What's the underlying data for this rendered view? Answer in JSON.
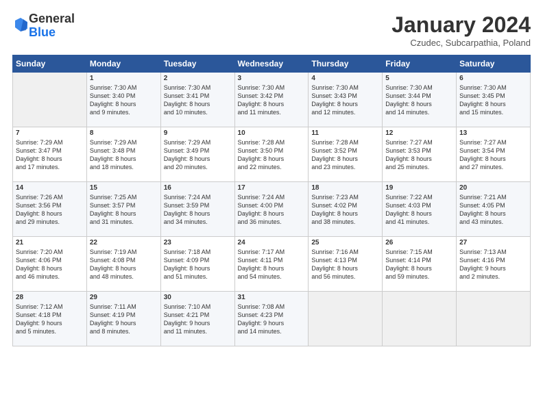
{
  "header": {
    "logo_general": "General",
    "logo_blue": "Blue",
    "month": "January 2024",
    "location": "Czudec, Subcarpathia, Poland"
  },
  "days_of_week": [
    "Sunday",
    "Monday",
    "Tuesday",
    "Wednesday",
    "Thursday",
    "Friday",
    "Saturday"
  ],
  "weeks": [
    [
      {
        "day": "",
        "text": ""
      },
      {
        "day": "1",
        "text": "Sunrise: 7:30 AM\nSunset: 3:40 PM\nDaylight: 8 hours\nand 9 minutes."
      },
      {
        "day": "2",
        "text": "Sunrise: 7:30 AM\nSunset: 3:41 PM\nDaylight: 8 hours\nand 10 minutes."
      },
      {
        "day": "3",
        "text": "Sunrise: 7:30 AM\nSunset: 3:42 PM\nDaylight: 8 hours\nand 11 minutes."
      },
      {
        "day": "4",
        "text": "Sunrise: 7:30 AM\nSunset: 3:43 PM\nDaylight: 8 hours\nand 12 minutes."
      },
      {
        "day": "5",
        "text": "Sunrise: 7:30 AM\nSunset: 3:44 PM\nDaylight: 8 hours\nand 14 minutes."
      },
      {
        "day": "6",
        "text": "Sunrise: 7:30 AM\nSunset: 3:45 PM\nDaylight: 8 hours\nand 15 minutes."
      }
    ],
    [
      {
        "day": "7",
        "text": "Sunrise: 7:29 AM\nSunset: 3:47 PM\nDaylight: 8 hours\nand 17 minutes."
      },
      {
        "day": "8",
        "text": "Sunrise: 7:29 AM\nSunset: 3:48 PM\nDaylight: 8 hours\nand 18 minutes."
      },
      {
        "day": "9",
        "text": "Sunrise: 7:29 AM\nSunset: 3:49 PM\nDaylight: 8 hours\nand 20 minutes."
      },
      {
        "day": "10",
        "text": "Sunrise: 7:28 AM\nSunset: 3:50 PM\nDaylight: 8 hours\nand 22 minutes."
      },
      {
        "day": "11",
        "text": "Sunrise: 7:28 AM\nSunset: 3:52 PM\nDaylight: 8 hours\nand 23 minutes."
      },
      {
        "day": "12",
        "text": "Sunrise: 7:27 AM\nSunset: 3:53 PM\nDaylight: 8 hours\nand 25 minutes."
      },
      {
        "day": "13",
        "text": "Sunrise: 7:27 AM\nSunset: 3:54 PM\nDaylight: 8 hours\nand 27 minutes."
      }
    ],
    [
      {
        "day": "14",
        "text": "Sunrise: 7:26 AM\nSunset: 3:56 PM\nDaylight: 8 hours\nand 29 minutes."
      },
      {
        "day": "15",
        "text": "Sunrise: 7:25 AM\nSunset: 3:57 PM\nDaylight: 8 hours\nand 31 minutes."
      },
      {
        "day": "16",
        "text": "Sunrise: 7:24 AM\nSunset: 3:59 PM\nDaylight: 8 hours\nand 34 minutes."
      },
      {
        "day": "17",
        "text": "Sunrise: 7:24 AM\nSunset: 4:00 PM\nDaylight: 8 hours\nand 36 minutes."
      },
      {
        "day": "18",
        "text": "Sunrise: 7:23 AM\nSunset: 4:02 PM\nDaylight: 8 hours\nand 38 minutes."
      },
      {
        "day": "19",
        "text": "Sunrise: 7:22 AM\nSunset: 4:03 PM\nDaylight: 8 hours\nand 41 minutes."
      },
      {
        "day": "20",
        "text": "Sunrise: 7:21 AM\nSunset: 4:05 PM\nDaylight: 8 hours\nand 43 minutes."
      }
    ],
    [
      {
        "day": "21",
        "text": "Sunrise: 7:20 AM\nSunset: 4:06 PM\nDaylight: 8 hours\nand 46 minutes."
      },
      {
        "day": "22",
        "text": "Sunrise: 7:19 AM\nSunset: 4:08 PM\nDaylight: 8 hours\nand 48 minutes."
      },
      {
        "day": "23",
        "text": "Sunrise: 7:18 AM\nSunset: 4:09 PM\nDaylight: 8 hours\nand 51 minutes."
      },
      {
        "day": "24",
        "text": "Sunrise: 7:17 AM\nSunset: 4:11 PM\nDaylight: 8 hours\nand 54 minutes."
      },
      {
        "day": "25",
        "text": "Sunrise: 7:16 AM\nSunset: 4:13 PM\nDaylight: 8 hours\nand 56 minutes."
      },
      {
        "day": "26",
        "text": "Sunrise: 7:15 AM\nSunset: 4:14 PM\nDaylight: 8 hours\nand 59 minutes."
      },
      {
        "day": "27",
        "text": "Sunrise: 7:13 AM\nSunset: 4:16 PM\nDaylight: 9 hours\nand 2 minutes."
      }
    ],
    [
      {
        "day": "28",
        "text": "Sunrise: 7:12 AM\nSunset: 4:18 PM\nDaylight: 9 hours\nand 5 minutes."
      },
      {
        "day": "29",
        "text": "Sunrise: 7:11 AM\nSunset: 4:19 PM\nDaylight: 9 hours\nand 8 minutes."
      },
      {
        "day": "30",
        "text": "Sunrise: 7:10 AM\nSunset: 4:21 PM\nDaylight: 9 hours\nand 11 minutes."
      },
      {
        "day": "31",
        "text": "Sunrise: 7:08 AM\nSunset: 4:23 PM\nDaylight: 9 hours\nand 14 minutes."
      },
      {
        "day": "",
        "text": ""
      },
      {
        "day": "",
        "text": ""
      },
      {
        "day": "",
        "text": ""
      }
    ]
  ]
}
